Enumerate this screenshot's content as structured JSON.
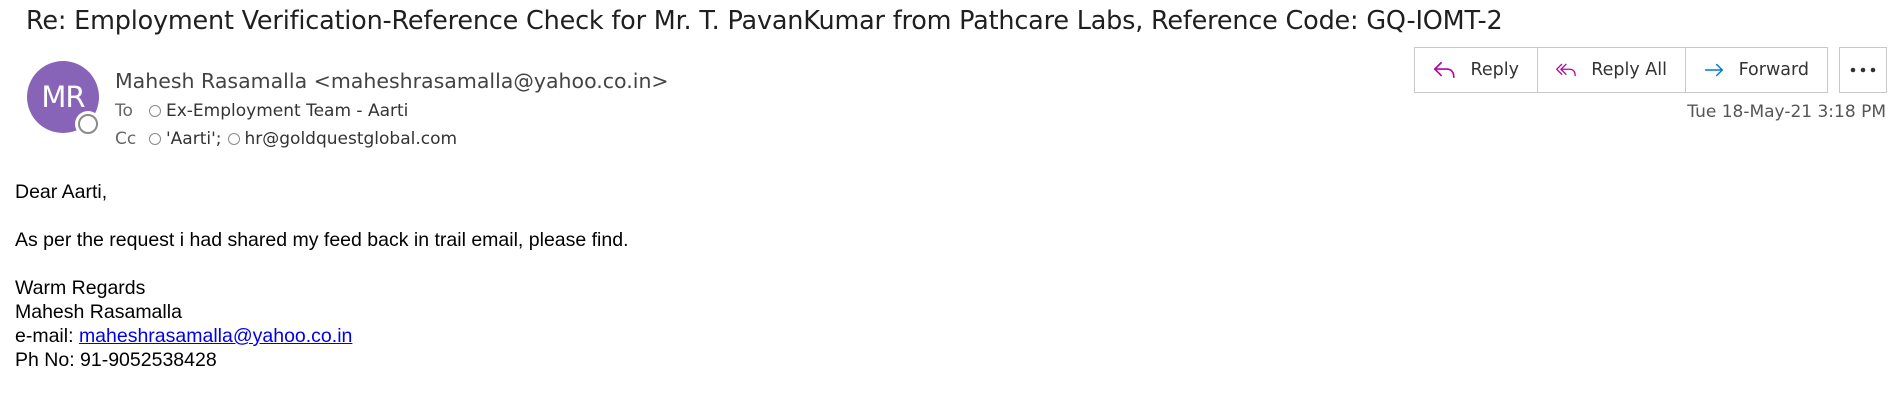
{
  "email": {
    "subject": "Re: Employment Verification-Reference Check for Mr. T. PavanKumar from Pathcare Labs, Reference Code: GQ-IOMT-2",
    "sender": {
      "initials": "MR",
      "display": "Mahesh Rasamalla <maheshrasamalla@yahoo.co.in>",
      "avatar_color": "#8764b8"
    },
    "to": {
      "label": "To",
      "recipient": "Ex-Employment Team - Aarti"
    },
    "cc": {
      "label": "Cc",
      "recipient1": "'Aarti';",
      "recipient2": "hr@goldquestglobal.com"
    },
    "timestamp": "Tue 18-May-21 3:18 PM"
  },
  "actions": {
    "reply": "Reply",
    "reply_all": "Reply All",
    "forward": "Forward",
    "accent_reply": "#b4009e",
    "accent_forward": "#0078d4"
  },
  "body": {
    "greeting": "Dear Aarti,",
    "message": "As per the request i had shared my feed back in trail email, please find.",
    "closing": "Warm Regards",
    "signature_name": "Mahesh Rasamalla",
    "email_label": "e-mail: ",
    "email_link": "maheshrasamalla@yahoo.co.in",
    "phone": "Ph No: 91-9052538428"
  }
}
